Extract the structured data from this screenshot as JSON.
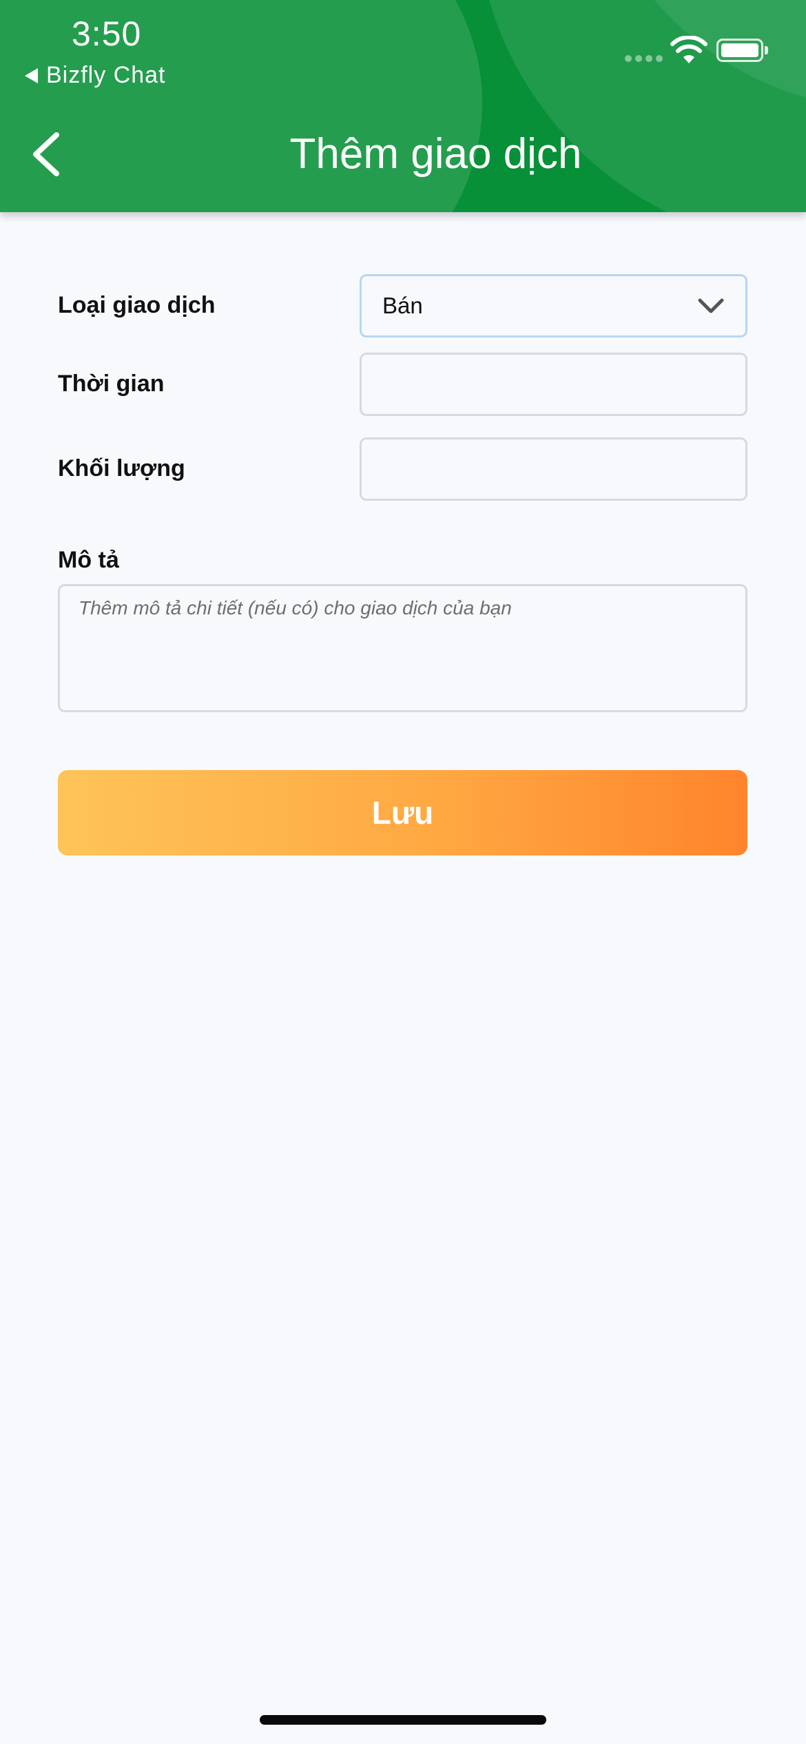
{
  "status_bar": {
    "time": "3:50",
    "back_app": "Bizfly Chat"
  },
  "header": {
    "title": "Thêm giao dịch",
    "background_color": "#079037"
  },
  "form": {
    "transaction_type": {
      "label": "Loại giao dịch",
      "value": "Bán"
    },
    "time": {
      "label": "Thời gian",
      "value": ""
    },
    "quantity": {
      "label": "Khối lượng",
      "value": ""
    },
    "description": {
      "label": "Mô tả",
      "placeholder": "Thêm mô tả chi tiết (nếu có) cho giao dịch của bạn"
    }
  },
  "actions": {
    "save_label": "Lưu",
    "gradient_colors": [
      "#fec459",
      "#ff842c"
    ]
  },
  "icons": {
    "back": "chevron-left-icon",
    "dropdown": "chevron-down-icon",
    "wifi": "wifi-icon",
    "battery": "battery-icon",
    "signal": "signal-icon"
  }
}
